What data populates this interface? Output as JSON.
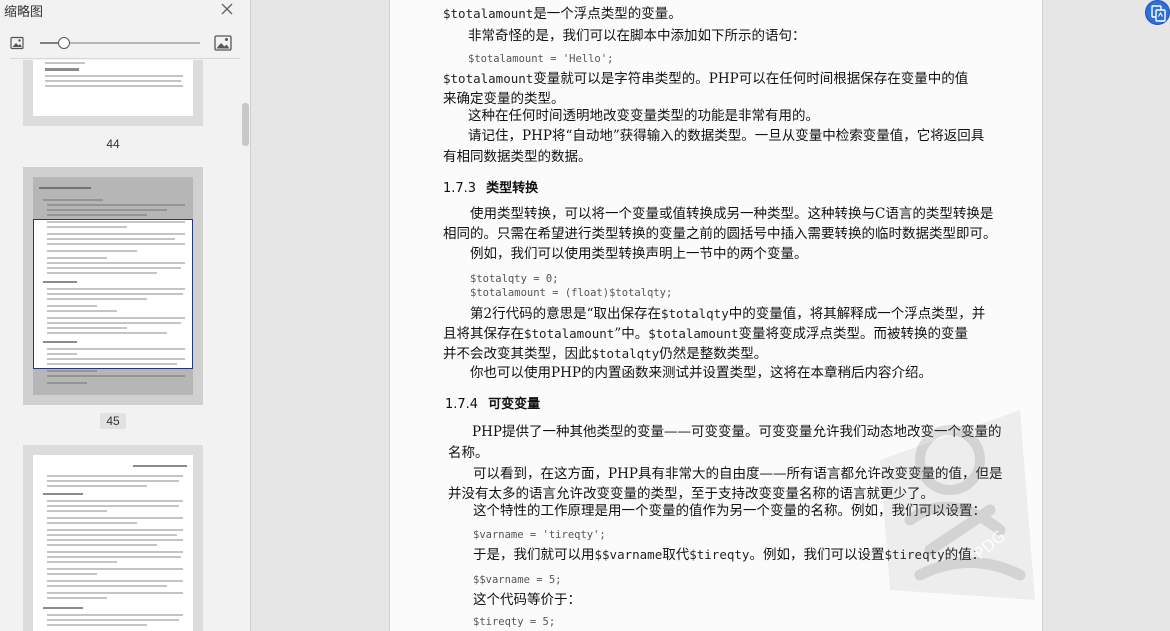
{
  "sidebar": {
    "title": "缩略图",
    "zoom_level": 0.15,
    "thumbnails": [
      {
        "page_number": "44",
        "selected": false
      },
      {
        "page_number": "45",
        "selected": true
      },
      {
        "page_number": "",
        "selected": false
      }
    ]
  },
  "document": {
    "lines": [
      {
        "segs": [
          [
            "code",
            "$totalamount"
          ],
          [
            "text",
            "是一个浮点类型的变量。"
          ]
        ]
      },
      {
        "segs": [
          [
            "text",
            "非常奇怪的是，我们可以在脚本中添加如下所示的语句："
          ]
        ]
      },
      {
        "segs": [
          [
            "code",
            "$totalamount = 'Hello';"
          ]
        ]
      },
      {
        "segs": [
          [
            "code",
            "$totalamount"
          ],
          [
            "text",
            "变量就可以是字符串类型的。PHP可以在任何时间根据保存在变量中的值"
          ]
        ]
      },
      {
        "segs": [
          [
            "text",
            "来确定变量的类型。"
          ]
        ]
      },
      {
        "segs": [
          [
            "text",
            "这种在任何时间透明地改变变量类型的功能是非常有用的。"
          ]
        ]
      },
      {
        "segs": [
          [
            "text",
            "请记住，PHP将“自动地”获得输入的数据类型。一旦从变量中检索变量值，它将返回具"
          ]
        ]
      },
      {
        "segs": [
          [
            "text",
            "有相同数据类型的数据。"
          ]
        ]
      },
      {
        "heading": {
          "number": "1.7.3",
          "title": "类型转换"
        }
      },
      {
        "segs": [
          [
            "text",
            "使用类型转换，可以将一个变量或值转换成另一种类型。这种转换与C语言的类型转换是"
          ]
        ]
      },
      {
        "segs": [
          [
            "text",
            "相同的。只需在希望进行类型转换的变量之前的圆括号中插入需要转换的临时数据类型即可。"
          ]
        ]
      },
      {
        "segs": [
          [
            "text",
            "例如，我们可以使用类型转换声明上一节中的两个变量。"
          ]
        ]
      },
      {
        "segs": [
          [
            "code",
            "$totalqty = 0;"
          ]
        ]
      },
      {
        "segs": [
          [
            "code",
            "$totalamount = (float)$totalqty;"
          ]
        ]
      },
      {
        "segs": [
          [
            "text",
            "第2行代码的意思是“取出保存在"
          ],
          [
            "code",
            "$totalqty"
          ],
          [
            "text",
            "中的变量值，将其解释成一个浮点类型，并"
          ]
        ]
      },
      {
        "segs": [
          [
            "text",
            "且将其保存在"
          ],
          [
            "code",
            "$totalamount"
          ],
          [
            "text",
            "”中。"
          ],
          [
            "code",
            "$totalamount"
          ],
          [
            "text",
            "变量将变成浮点类型。而被转换的变量"
          ]
        ]
      },
      {
        "segs": [
          [
            "text",
            "并不会改变其类型，因此"
          ],
          [
            "code",
            "$totalqty"
          ],
          [
            "text",
            "仍然是整数类型。"
          ]
        ]
      },
      {
        "segs": [
          [
            "text",
            "你也可以使用PHP的内置函数来测试并设置类型，这将在本章稍后内容介绍。"
          ]
        ]
      },
      {
        "heading": {
          "number": "1.7.4",
          "title": "可变变量"
        }
      },
      {
        "segs": [
          [
            "text",
            "PHP提供了一种其他类型的变量——可变变量。可变变量允许我们动态地改变一个变量的"
          ]
        ]
      },
      {
        "segs": [
          [
            "text",
            "名称。"
          ]
        ]
      },
      {
        "segs": [
          [
            "text",
            "可以看到，在这方面，PHP具有非常大的自由度——所有语言都允许改变变量的值，但是"
          ]
        ]
      },
      {
        "segs": [
          [
            "text",
            "并没有太多的语言允许改变变量的类型，至于支持改变变量名称的语言就更少了。"
          ]
        ]
      },
      {
        "segs": [
          [
            "text",
            "这个特性的工作原理是用一个变量的值作为另一个变量的名称。例如，我们可以设置："
          ]
        ]
      },
      {
        "segs": [
          [
            "code",
            "$varname = 'tireqty';"
          ]
        ]
      },
      {
        "segs": [
          [
            "text",
            "于是，我们就可以用"
          ],
          [
            "code",
            "$$varname"
          ],
          [
            "text",
            "取代"
          ],
          [
            "code",
            "$tireqty"
          ],
          [
            "text",
            "。例如，我们可以设置"
          ],
          [
            "code",
            "$tireqty"
          ],
          [
            "text",
            "的值："
          ]
        ]
      },
      {
        "segs": [
          [
            "code",
            "$$varname = 5;"
          ]
        ]
      },
      {
        "segs": [
          [
            "text",
            "这个代码等价于："
          ]
        ]
      },
      {
        "segs": [
          [
            "code",
            "$tireqty = 5;"
          ]
        ]
      }
    ]
  },
  "watermark_text": "PDG",
  "colors": {
    "accent": "#2f6fd9",
    "selection_border": "#24357a"
  }
}
